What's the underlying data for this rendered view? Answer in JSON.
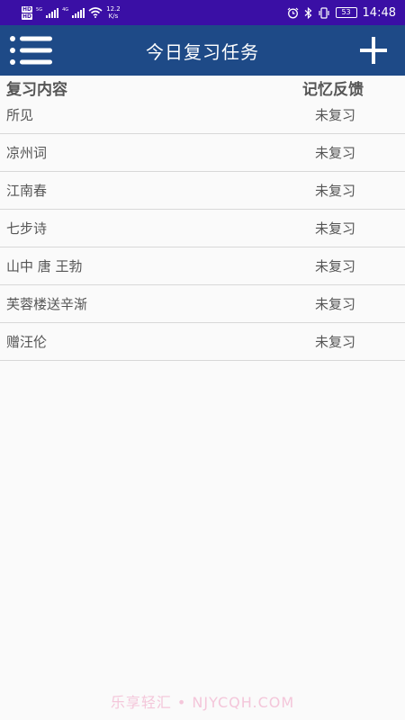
{
  "status_bar": {
    "hd1": "HD",
    "hd2": "HD",
    "net1": "5G",
    "net2": "4G",
    "speed_value": "12.2",
    "speed_unit": "K/s",
    "battery": "53",
    "time": "14:48"
  },
  "app_bar": {
    "title": "今日复习任务",
    "menu_icon": "list-menu-icon",
    "add_icon": "plus-icon"
  },
  "table": {
    "header_content": "复习内容",
    "header_feedback": "记忆反馈",
    "rows": [
      {
        "name": "所见",
        "status": "未复习"
      },
      {
        "name": "凉州词",
        "status": "未复习"
      },
      {
        "name": "江南春",
        "status": "未复习"
      },
      {
        "name": "七步诗",
        "status": "未复习"
      },
      {
        "name": "山中 唐 王勃",
        "status": "未复习"
      },
      {
        "name": "芙蓉楼送辛渐",
        "status": "未复习"
      },
      {
        "name": "赠汪伦",
        "status": "未复习"
      }
    ]
  },
  "watermark": "乐享轻汇 • NJYCQH.COM",
  "colors": {
    "status_bar": "#3a0fa5",
    "app_bar": "#1e4a87",
    "background": "#fafafa",
    "divider": "#d8d8d8"
  }
}
